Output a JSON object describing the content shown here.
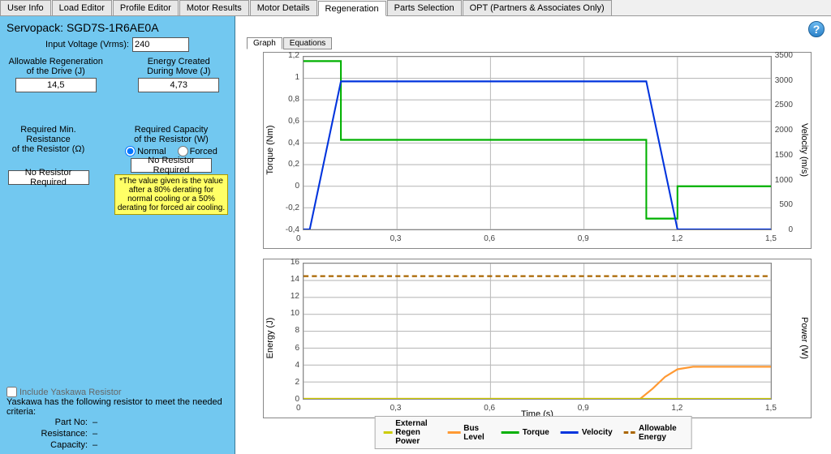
{
  "tabs": [
    "User Info",
    "Load Editor",
    "Profile Editor",
    "Motor Results",
    "Motor Details",
    "Regeneration",
    "Parts Selection",
    "OPT (Partners & Associates Only)"
  ],
  "active_tab": 5,
  "subtabs": {
    "graph": "Graph",
    "equations": "Equations"
  },
  "side": {
    "servo_label": "Servopack:",
    "servo_value": "SGD7S-1R6AE0A",
    "voltage_label": "Input Voltage (Vrms):",
    "voltage_value": "240",
    "allow_regen_label": "Allowable Regeneration\nof the Drive (J)",
    "allow_regen_value": "14,5",
    "energy_created_label": "Energy Created\nDuring Move (J)",
    "energy_created_value": "4,73",
    "req_res_label": "Required Min. Resistance\nof the Resistor (Ω)",
    "req_res_value": "No Resistor Required",
    "req_cap_label": "Required Capacity\nof the Resistor (W)",
    "req_cap_value": "No Resistor Required",
    "cooling_normal": "Normal",
    "cooling_forced": "Forced",
    "note": "*The value given is the value after a 80% derating for normal cooling or a 50% derating for forced air cooling.",
    "include_chk": "Include Yaskawa Resistor",
    "criteria_text": "Yaskawa has the following resistor to meet the needed criteria:",
    "fields": {
      "part_no": "Part No:",
      "resistance": "Resistance:",
      "capacity": "Capacity:"
    },
    "dash": "–"
  },
  "legend": {
    "ext": "External Regen Power",
    "bus": "Bus Level",
    "torque": "Torque",
    "vel": "Velocity",
    "allow": "Allowable Energy"
  },
  "colors": {
    "ext": "#cccc00",
    "bus": "#ff9933",
    "torque": "#00b000",
    "vel": "#0033dd",
    "allow": "#aa6600"
  },
  "axis": {
    "torque": "Torque (Nm)",
    "velocity": "Velocity (m/s)",
    "energy": "Energy (J)",
    "power": "Power (W)",
    "time": "Time (s)"
  },
  "chart_data": [
    {
      "type": "line",
      "xlim": [
        0,
        1.5
      ],
      "x_ticks": [
        0,
        0.3,
        0.6,
        0.9,
        1.2,
        1.5
      ],
      "left_axis": {
        "label": "Torque (Nm)",
        "lim": [
          -0.4,
          1.2
        ],
        "ticks": [
          -0.4,
          -0.2,
          0,
          0.2,
          0.4,
          0.6,
          0.8,
          1,
          1.2
        ]
      },
      "right_axis": {
        "label": "Velocity (m/s)",
        "lim": [
          0,
          3500
        ],
        "ticks": [
          0,
          500,
          1000,
          1500,
          2000,
          2500,
          3000,
          3500
        ]
      },
      "series": [
        {
          "name": "Torque",
          "axis": "left",
          "color": "#00b000",
          "x": [
            0,
            0.02,
            0.12,
            0.12,
            1.1,
            1.1,
            1.2,
            1.2,
            1.5
          ],
          "y": [
            1.16,
            1.16,
            1.16,
            0.43,
            0.43,
            -0.3,
            -0.3,
            0,
            0
          ]
        },
        {
          "name": "Velocity",
          "axis": "right",
          "color": "#0033dd",
          "x": [
            0,
            0.02,
            0.12,
            1.1,
            1.2,
            1.5
          ],
          "y": [
            0,
            0,
            3000,
            3000,
            0,
            0
          ]
        }
      ]
    },
    {
      "type": "line",
      "xlim": [
        0,
        1.5
      ],
      "x_ticks": [
        0,
        0.3,
        0.6,
        0.9,
        1.2,
        1.5
      ],
      "left_axis": {
        "label": "Energy (J)",
        "lim": [
          0,
          16
        ],
        "ticks": [
          0,
          2,
          4,
          6,
          8,
          10,
          12,
          14,
          16
        ]
      },
      "right_axis": {
        "label": "Power (W)",
        "lim": [
          0,
          16
        ],
        "ticks": []
      },
      "series": [
        {
          "name": "Allowable Energy",
          "axis": "left",
          "color": "#aa6600",
          "dash": true,
          "x": [
            0,
            1.5
          ],
          "y": [
            14.5,
            14.5
          ]
        },
        {
          "name": "Bus Level",
          "axis": "left",
          "color": "#ff9933",
          "x": [
            0,
            1.08,
            1.12,
            1.16,
            1.2,
            1.25,
            1.5
          ],
          "y": [
            0,
            0,
            1.2,
            2.6,
            3.5,
            3.8,
            3.8
          ]
        },
        {
          "name": "External Regen Power",
          "axis": "left",
          "color": "#cccc00",
          "x": [
            0,
            1.5
          ],
          "y": [
            0,
            0
          ]
        }
      ]
    }
  ]
}
